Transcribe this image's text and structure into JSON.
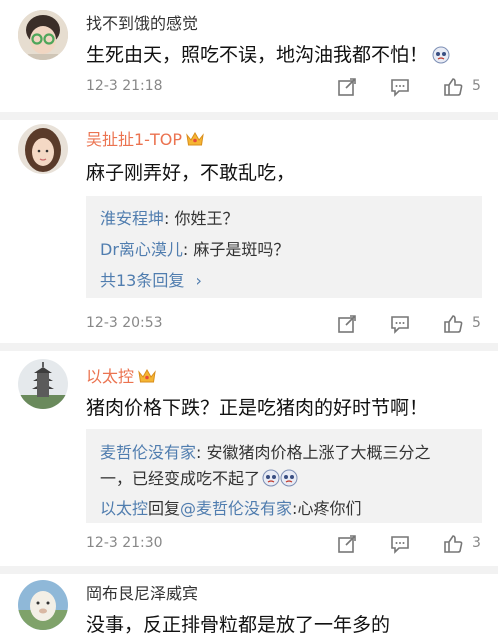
{
  "comments": [
    {
      "username": "找不到饿的感觉",
      "text": "生死由天，照吃不误，地沟油我都不怕！",
      "time": "12-3 21:18",
      "likes": "5",
      "vip": false
    },
    {
      "username": "吴扯扯1-TOP",
      "text": "麻子刚弄好，不敢乱吃，",
      "time": "12-3 20:53",
      "likes": "5",
      "vip": true,
      "replies": [
        {
          "user": "淮安程坤",
          "text": ": 你姓王？"
        },
        {
          "user": "Dr离心漠儿",
          "text": ": 麻子是斑吗？"
        }
      ],
      "more_replies": "共13条回复"
    },
    {
      "username": "以太控",
      "text": "猪肉价格下跌？正是吃猪肉的好时节啊！",
      "time": "12-3 21:30",
      "likes": "3",
      "vip": true,
      "replies": [
        {
          "user": "麦哲伦没有家",
          "text": ": 安徽猪肉价格上涨了大概三分之",
          "cont": "一，已经变成吃不起了"
        },
        {
          "user": "以太控",
          "mid": "回复",
          "mention": "@麦哲伦没有家",
          "text": ":心疼你们"
        }
      ]
    },
    {
      "username": "岡布艮尼泽威宾",
      "text": "没事，反正排骨粒都是放了一年多的",
      "vip": false
    }
  ],
  "icons": [
    "repost-icon",
    "comment-icon",
    "like-icon",
    "crown-icon",
    "emoji-icon"
  ],
  "colors": {
    "link": "#507daf",
    "vip_name": "#eb7350",
    "meta": "#888888",
    "reply_bg": "#f2f2f2"
  }
}
